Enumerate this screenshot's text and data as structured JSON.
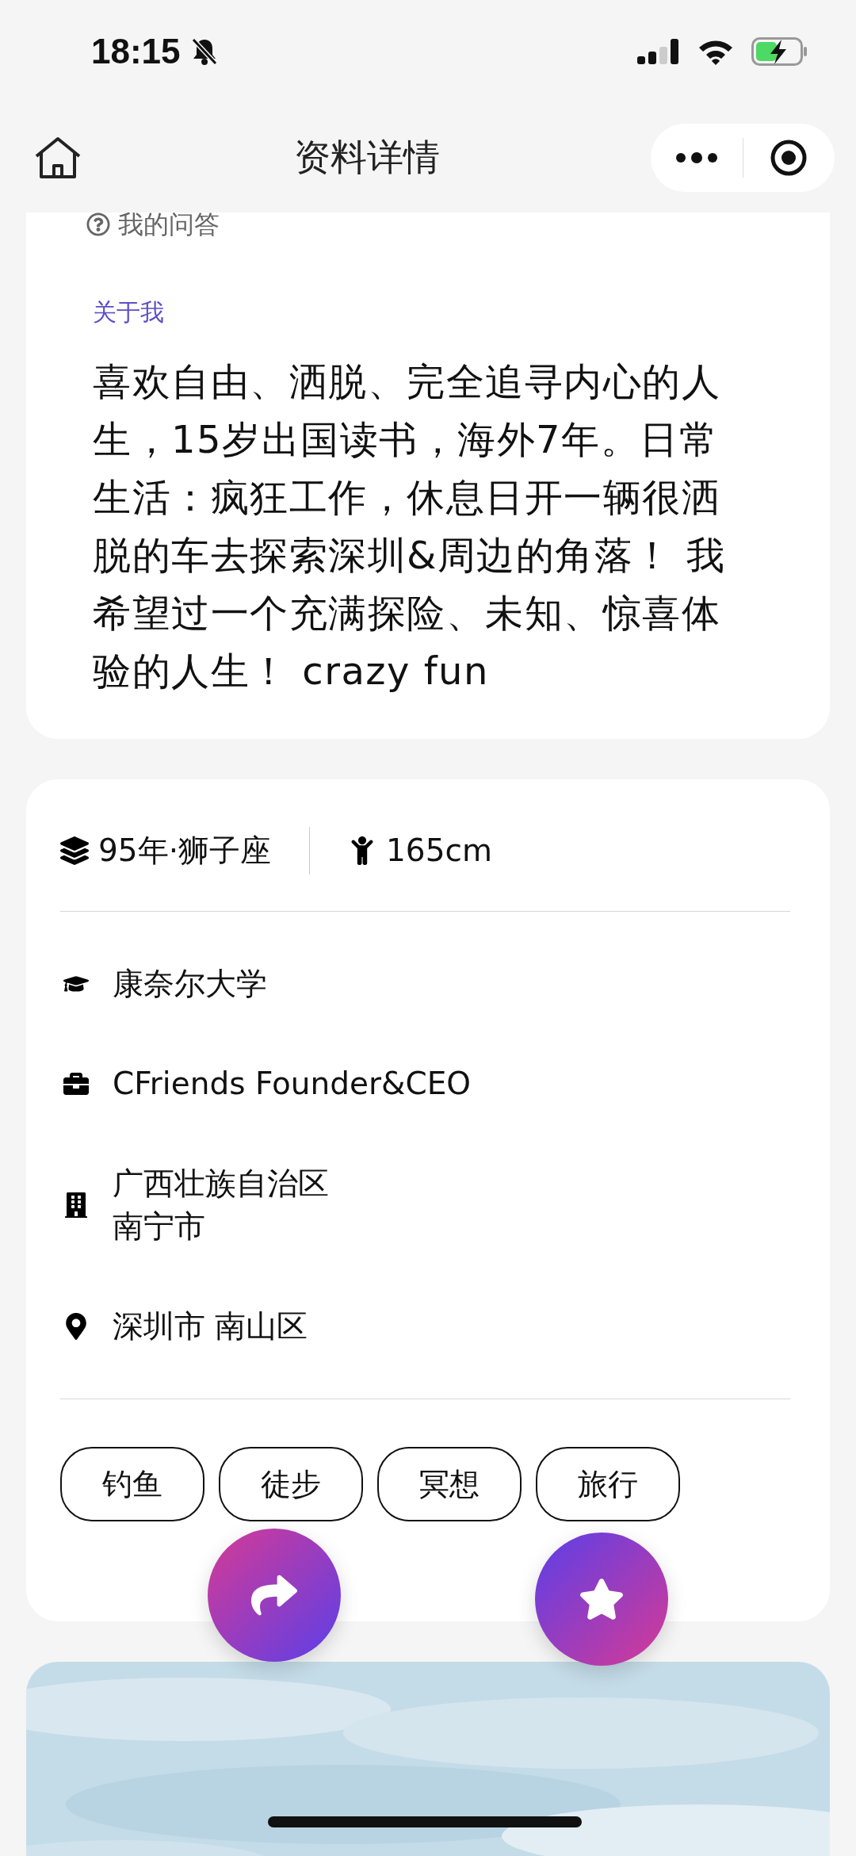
{
  "status_bar": {
    "time": "18:15"
  },
  "nav": {
    "title": "资料详情"
  },
  "about_card": {
    "qa_label": "我的问答",
    "section_label": "关于我",
    "bio": "喜欢自由、洒脱、完全追寻内心的人生，15岁出国读书，海外7年。日常生活：疯狂工作，休息日开一辆很洒脱的车去探索深圳&周边的角落！ 我希望过一个充满探险、未知、惊喜体验的人生！ crazy fun"
  },
  "info_card": {
    "birth": "95年·狮子座",
    "height": "165cm",
    "rows": [
      {
        "kind": "school",
        "text": "康奈尔大学"
      },
      {
        "kind": "job",
        "text": "CFriends Founder&CEO"
      },
      {
        "kind": "hometown",
        "text": "广西壮族自治区南宁市"
      },
      {
        "kind": "location",
        "text": "深圳市 南山区"
      }
    ],
    "tags": [
      "钓鱼",
      "徒步",
      "冥想",
      "旅行"
    ]
  },
  "fabs": [
    {
      "kind": "share"
    },
    {
      "kind": "favorite"
    }
  ]
}
